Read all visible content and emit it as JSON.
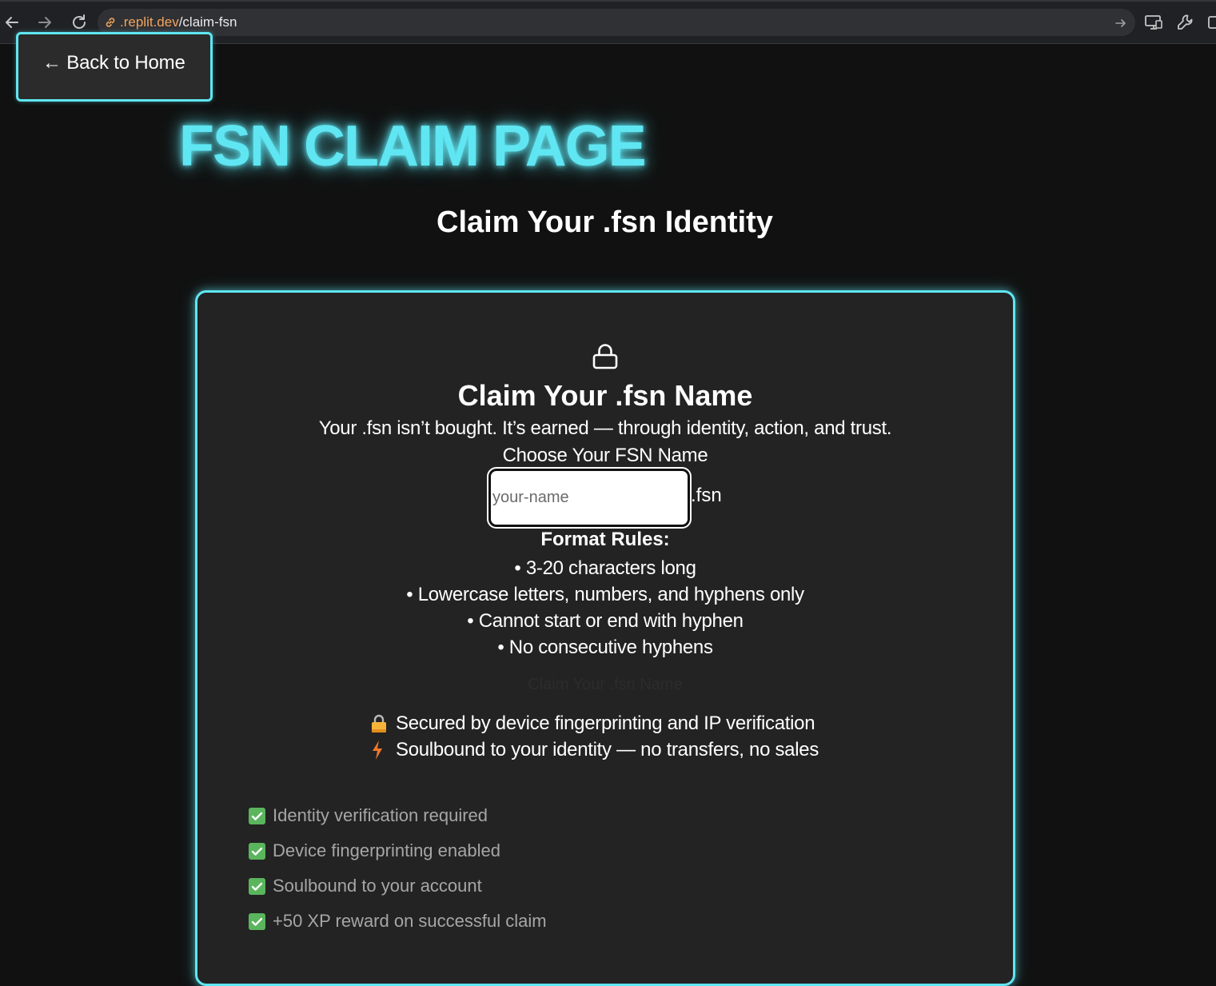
{
  "browser": {
    "url_host": ".replit.dev",
    "url_path": "/claim-fsn"
  },
  "colors": {
    "accent": "#5fe6f2",
    "background": "#111111",
    "card": "#232323",
    "check": "#5ab55d"
  },
  "header": {
    "back_label": "← Back to Home",
    "page_title": "FSN CLAIM PAGE",
    "subtitle": "Claim Your .fsn Identity"
  },
  "card": {
    "icon": "lock-icon",
    "title": "Claim Your .fsn Name",
    "tagline": "Your .fsn isn’t bought. It’s earned — through identity, action, and trust.",
    "field_label": "Choose Your FSN Name",
    "input_placeholder": "your-name",
    "input_value": "",
    "suffix": ".fsn",
    "rules_title": "Format Rules:",
    "rules": [
      "• 3-20 characters long",
      "• Lowercase letters, numbers, and hyphens only",
      "• Cannot start or end with hyphen",
      "• No consecutive hyphens"
    ],
    "submit_label": "Claim Your .fsn Name",
    "security": [
      {
        "icon": "lock-emoji-icon",
        "text": "Secured by device fingerprinting and IP verification"
      },
      {
        "icon": "lightning-icon",
        "text": "Soulbound to your identity — no transfers, no sales"
      }
    ],
    "checks": [
      "Identity verification required",
      "Device fingerprinting enabled",
      "Soulbound to your account",
      "+50 XP reward on successful claim"
    ]
  }
}
